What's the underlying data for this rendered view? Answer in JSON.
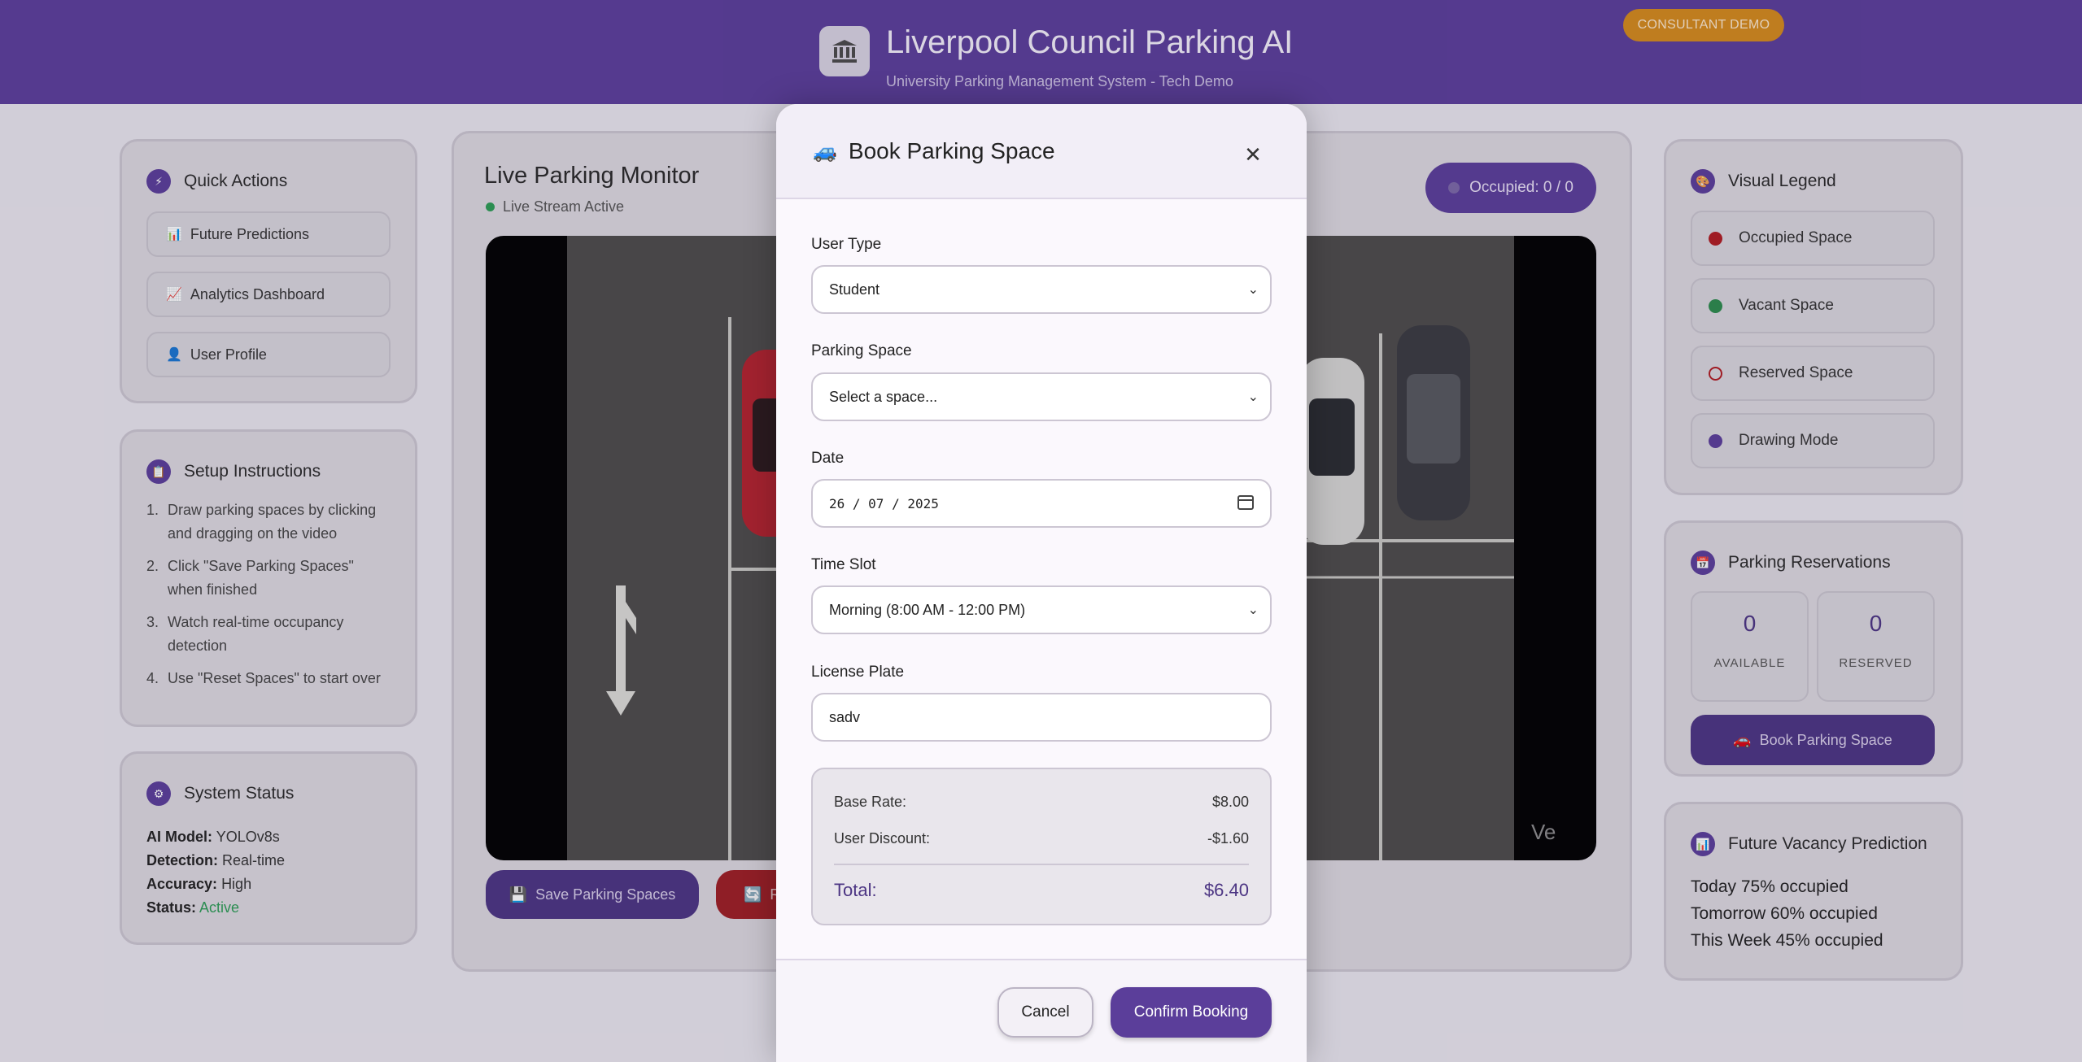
{
  "header": {
    "title": "Liverpool Council Parking AI",
    "subtitle": "University Parking Management System - Tech Demo",
    "consultant_badge": "CONSULTANT DEMO"
  },
  "quick_actions": {
    "title": "Quick Actions",
    "items": [
      {
        "icon": "bar-chart-icon",
        "label": "Future Predictions"
      },
      {
        "icon": "trend-chart-icon",
        "label": "Analytics Dashboard"
      },
      {
        "icon": "user-icon",
        "label": "User Profile"
      }
    ]
  },
  "setup": {
    "title": "Setup Instructions",
    "steps": [
      "Draw parking spaces by clicking and dragging on the video",
      "Click \"Save Parking Spaces\" when finished",
      "Watch real-time occupancy detection",
      "Use \"Reset Spaces\" to start over"
    ]
  },
  "system_status": {
    "title": "System Status",
    "rows": [
      {
        "label": "AI Model:",
        "value": "YOLOv8s"
      },
      {
        "label": "Detection:",
        "value": "Real-time"
      },
      {
        "label": "Accuracy:",
        "value": "High"
      },
      {
        "label": "Status:",
        "value": "Active",
        "color": "#2c9c55"
      }
    ]
  },
  "monitor": {
    "title": "Live Parking Monitor",
    "live_label": "Live Stream Active",
    "occupied_label": "Occupied: 0 / 0",
    "save_label": "Save Parking Spaces",
    "reset_label": "R"
  },
  "legend": {
    "title": "Visual Legend",
    "items": [
      {
        "label": "Occupied Space",
        "color": "#b01c22"
      },
      {
        "label": "Vacant Space",
        "color": "#2c8b4d"
      },
      {
        "label": "Reserved Space",
        "color": "#b01c22"
      },
      {
        "label": "Drawing Mode",
        "color": "#5b3e9a"
      }
    ]
  },
  "reservations": {
    "title": "Parking Reservations",
    "available_value": "0",
    "available_label": "AVAILABLE",
    "reserved_value": "0",
    "reserved_label": "RESERVED",
    "book_label": "Book Parking Space"
  },
  "prediction": {
    "title": "Future Vacancy Prediction",
    "lines": [
      "Today 75% occupied",
      "Tomorrow 60% occupied",
      "This Week 45% occupied"
    ]
  },
  "modal": {
    "title": "Book Parking Space",
    "user_type_label": "User Type",
    "user_type_value": "Student",
    "space_label": "Parking Space",
    "space_value": "Select a space...",
    "date_label": "Date",
    "date_value": "26 / 07 / 2025",
    "slot_label": "Time Slot",
    "slot_value": "Morning (8:00 AM - 12:00 PM)",
    "plate_label": "License Plate",
    "plate_value": "sadv",
    "base_rate_label": "Base Rate:",
    "base_rate_value": "$8.00",
    "discount_label": "User Discount:",
    "discount_value": "-$1.60",
    "total_label": "Total:",
    "total_value": "$6.40",
    "cancel_label": "Cancel",
    "confirm_label": "Confirm Booking"
  },
  "colors": {
    "brand": "#5b3e9a",
    "accent": "#d48a1c",
    "danger": "#9e1e24",
    "success": "#2c9c55"
  }
}
